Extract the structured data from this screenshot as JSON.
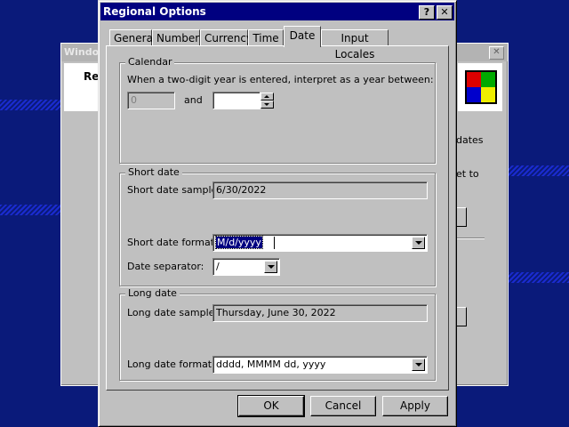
{
  "background_window": {
    "title": "Window",
    "label": "Re",
    "text1": "dates",
    "text2": "et to"
  },
  "dialog": {
    "title": "Regional Options",
    "help_label": "?",
    "close_label": "✕"
  },
  "tabs": [
    {
      "label": "General"
    },
    {
      "label": "Numbers"
    },
    {
      "label": "Currency"
    },
    {
      "label": "Time"
    },
    {
      "label": "Date"
    },
    {
      "label": "Input Locales"
    }
  ],
  "calendar": {
    "title": "Calendar",
    "description": "When a two-digit year is entered, interpret as a year between:",
    "from_value": "0",
    "and_label": "and",
    "to_value": ""
  },
  "short_date": {
    "title": "Short date",
    "sample_label": "Short date sample:",
    "sample_value": "6/30/2022",
    "format_label": "Short date format:",
    "format_value": "M/d/yyyy",
    "separator_label": "Date separator:",
    "separator_value": "/"
  },
  "long_date": {
    "title": "Long date",
    "sample_label": "Long date sample:",
    "sample_value": "Thursday, June 30, 2022",
    "format_label": "Long date format:",
    "format_value": "dddd, MMMM dd, yyyy"
  },
  "buttons": {
    "ok": "OK",
    "cancel": "Cancel",
    "apply": "Apply"
  },
  "colors": {
    "desktop": "#0a1a7a",
    "title_bar": "#000080",
    "face": "#c0c0c0"
  }
}
